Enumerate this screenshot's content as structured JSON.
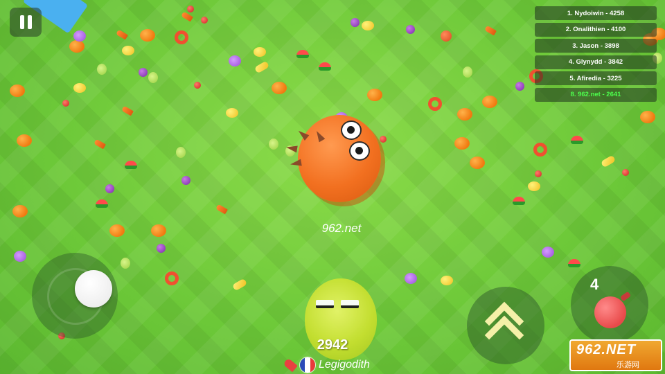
{
  "hud": {
    "pause_icon": "pause-icon"
  },
  "leaderboard": [
    {
      "text": "1. Nydoiwin - 4258",
      "is_player": false
    },
    {
      "text": "2. Onalithien - 4100",
      "is_player": false
    },
    {
      "text": "3. Jason - 3898",
      "is_player": false
    },
    {
      "text": "4. Glynydd - 3842",
      "is_player": false
    },
    {
      "text": "5. Afiredia - 3225",
      "is_player": false
    },
    {
      "text": "8. 962.net - 2641",
      "is_player": true
    }
  ],
  "enemy": {
    "name": "962.net",
    "color": "#f27020"
  },
  "player": {
    "score": "2942",
    "name": "Legigodith",
    "color": "#c8e030",
    "flag": "france-flag-icon"
  },
  "controls": {
    "joystick_icon": "joystick-icon",
    "boost_icon": "double-chevron-up-icon",
    "bomb_count": "4",
    "bomb_icon": "bomb-icon"
  },
  "watermark": {
    "brand": "962.NET",
    "sub": "乐游网"
  },
  "colors": {
    "grass": "#6ec83a",
    "leader_me": "#4cff4c"
  }
}
